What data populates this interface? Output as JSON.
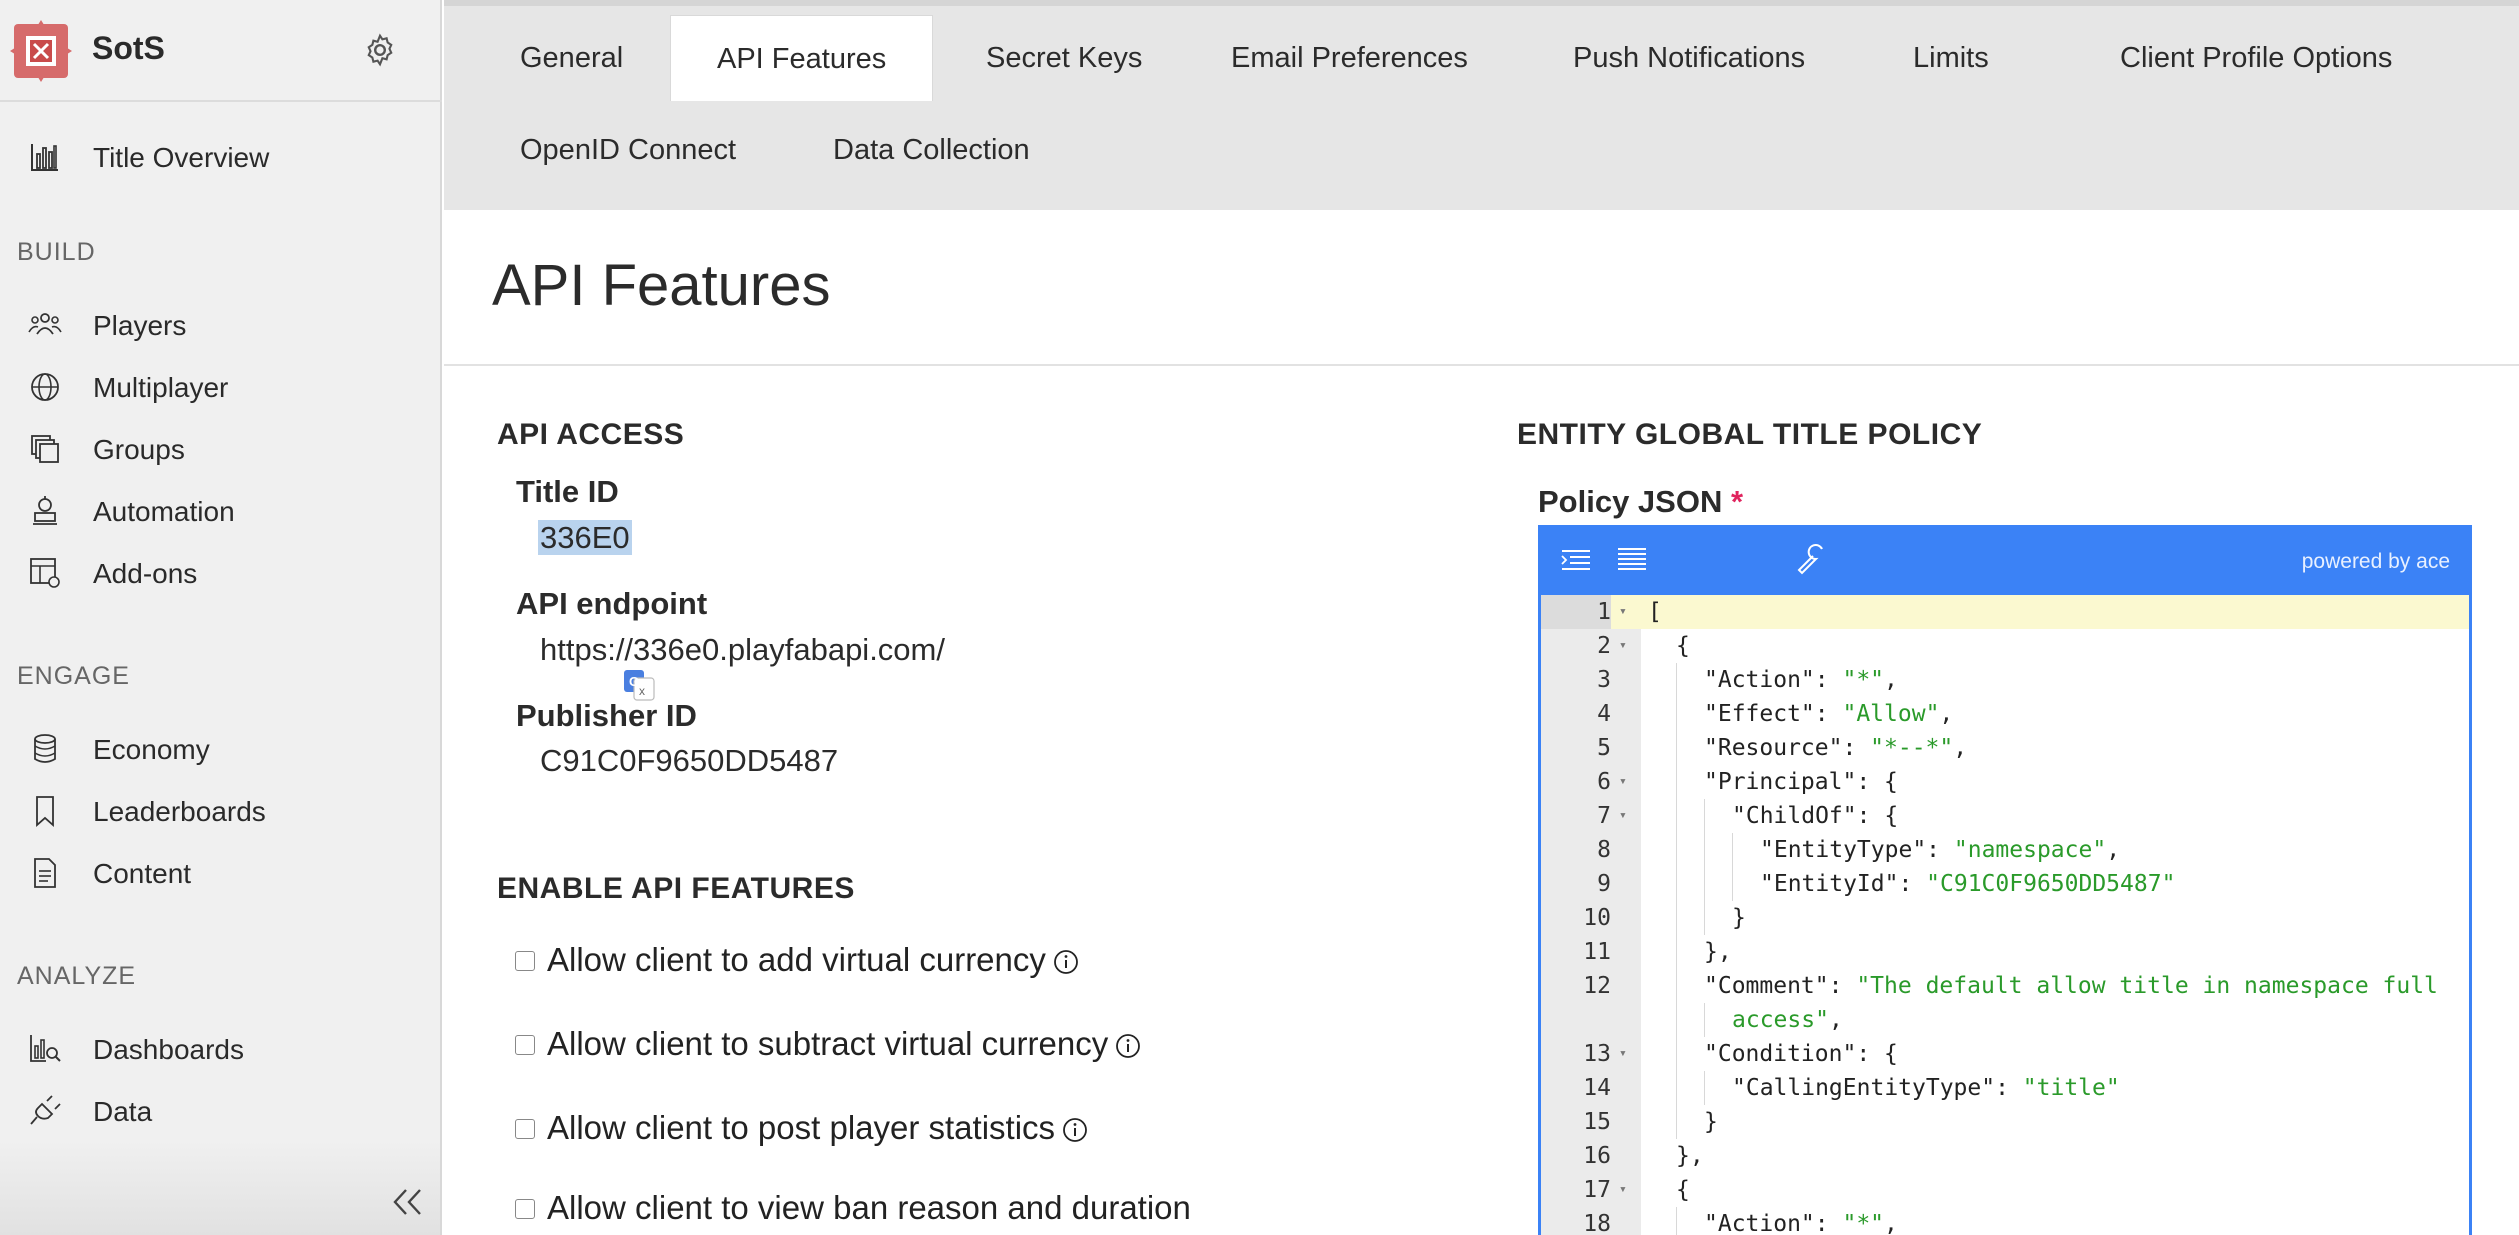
{
  "app": {
    "name": "SotS"
  },
  "sidebar": {
    "top_item": {
      "label": "Title Overview",
      "icon": "bar-chart-icon"
    },
    "sections": [
      {
        "label": "BUILD",
        "items": [
          {
            "label": "Players",
            "icon": "players-icon"
          },
          {
            "label": "Multiplayer",
            "icon": "globe-icon"
          },
          {
            "label": "Groups",
            "icon": "groups-icon"
          },
          {
            "label": "Automation",
            "icon": "automation-icon"
          },
          {
            "label": "Add-ons",
            "icon": "addons-icon"
          }
        ]
      },
      {
        "label": "ENGAGE",
        "items": [
          {
            "label": "Economy",
            "icon": "database-icon"
          },
          {
            "label": "Leaderboards",
            "icon": "bookmark-icon"
          },
          {
            "label": "Content",
            "icon": "document-icon"
          }
        ]
      },
      {
        "label": "ANALYZE",
        "items": [
          {
            "label": "Dashboards",
            "icon": "dashboards-icon"
          },
          {
            "label": "Data",
            "icon": "plug-icon"
          }
        ]
      }
    ],
    "collapse_glyph": "«"
  },
  "tabs": [
    {
      "label": "General"
    },
    {
      "label": "API Features",
      "active": true
    },
    {
      "label": "Secret Keys"
    },
    {
      "label": "Email Preferences"
    },
    {
      "label": "Push Notifications"
    },
    {
      "label": "Limits"
    },
    {
      "label": "Client Profile Options"
    },
    {
      "label": "OpenID Connect"
    },
    {
      "label": "Data Collection"
    }
  ],
  "page": {
    "title": "API Features"
  },
  "api_access": {
    "heading": "API ACCESS",
    "title_id_label": "Title ID",
    "title_id_value": "336E0",
    "endpoint_label": "API endpoint",
    "endpoint_value": "https://336e0.playfabapi.com/",
    "publisher_label": "Publisher ID",
    "publisher_value": "C91C0F9650DD5487"
  },
  "enable_features": {
    "heading": "ENABLE API FEATURES",
    "options": [
      {
        "label": "Allow client to add virtual currency",
        "checked": false,
        "info": true
      },
      {
        "label": "Allow client to subtract virtual currency",
        "checked": false,
        "info": true
      },
      {
        "label": "Allow client to post player statistics",
        "checked": false,
        "info": true
      },
      {
        "label": "Allow client to view ban reason and duration",
        "checked": false,
        "info": false
      }
    ]
  },
  "entity_policy": {
    "heading": "ENTITY GLOBAL TITLE POLICY",
    "policy_label": "Policy JSON",
    "required_mark": "*",
    "powered_by": "powered by ace",
    "accent_color": "#3b82f6",
    "lines": [
      {
        "n": "1",
        "fold": true,
        "indent": 0,
        "parts": [
          [
            "k",
            "["
          ]
        ]
      },
      {
        "n": "2",
        "fold": true,
        "indent": 1,
        "parts": [
          [
            "k",
            "{"
          ]
        ]
      },
      {
        "n": "3",
        "fold": false,
        "indent": 2,
        "parts": [
          [
            "k",
            "\"Action\": "
          ],
          [
            "s",
            "\"*\""
          ],
          [
            "k",
            ","
          ]
        ]
      },
      {
        "n": "4",
        "fold": false,
        "indent": 2,
        "parts": [
          [
            "k",
            "\"Effect\": "
          ],
          [
            "s",
            "\"Allow\""
          ],
          [
            "k",
            ","
          ]
        ]
      },
      {
        "n": "5",
        "fold": false,
        "indent": 2,
        "parts": [
          [
            "k",
            "\"Resource\": "
          ],
          [
            "s",
            "\"*--*\""
          ],
          [
            "k",
            ","
          ]
        ]
      },
      {
        "n": "6",
        "fold": true,
        "indent": 2,
        "parts": [
          [
            "k",
            "\"Principal\": {"
          ]
        ]
      },
      {
        "n": "7",
        "fold": true,
        "indent": 3,
        "parts": [
          [
            "k",
            "\"ChildOf\": {"
          ]
        ]
      },
      {
        "n": "8",
        "fold": false,
        "indent": 4,
        "parts": [
          [
            "k",
            "\"EntityType\": "
          ],
          [
            "s",
            "\"namespace\""
          ],
          [
            "k",
            ","
          ]
        ]
      },
      {
        "n": "9",
        "fold": false,
        "indent": 4,
        "parts": [
          [
            "k",
            "\"EntityId\": "
          ],
          [
            "s",
            "\"C91C0F9650DD5487\""
          ]
        ]
      },
      {
        "n": "10",
        "fold": false,
        "indent": 3,
        "parts": [
          [
            "k",
            "}"
          ]
        ]
      },
      {
        "n": "11",
        "fold": false,
        "indent": 2,
        "parts": [
          [
            "k",
            "},"
          ]
        ]
      },
      {
        "n": "12",
        "fold": false,
        "indent": 2,
        "parts": [
          [
            "k",
            "\"Comment\": "
          ],
          [
            "s",
            "\"The default allow title in namespace full"
          ]
        ]
      },
      {
        "n": "",
        "fold": false,
        "indent": 3,
        "parts": [
          [
            "s",
            "access\""
          ],
          [
            "k",
            ","
          ]
        ]
      },
      {
        "n": "13",
        "fold": true,
        "indent": 2,
        "parts": [
          [
            "k",
            "\"Condition\": {"
          ]
        ]
      },
      {
        "n": "14",
        "fold": false,
        "indent": 3,
        "parts": [
          [
            "k",
            "\"CallingEntityType\": "
          ],
          [
            "s",
            "\"title\""
          ]
        ]
      },
      {
        "n": "15",
        "fold": false,
        "indent": 2,
        "parts": [
          [
            "k",
            "}"
          ]
        ]
      },
      {
        "n": "16",
        "fold": false,
        "indent": 1,
        "parts": [
          [
            "k",
            "},"
          ]
        ]
      },
      {
        "n": "17",
        "fold": true,
        "indent": 1,
        "parts": [
          [
            "k",
            "{"
          ]
        ]
      },
      {
        "n": "18",
        "fold": false,
        "indent": 2,
        "parts": [
          [
            "k",
            "\"Action\": "
          ],
          [
            "s",
            "\"*\""
          ],
          [
            "k",
            ","
          ]
        ]
      }
    ]
  }
}
